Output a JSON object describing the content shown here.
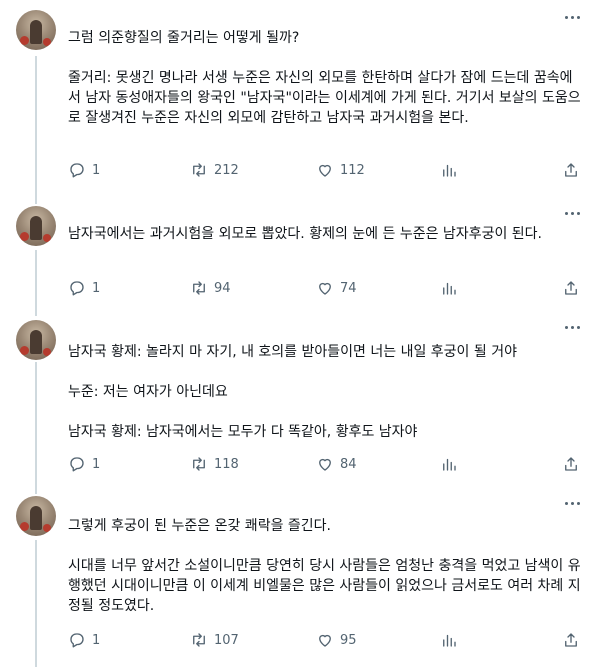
{
  "tweets": [
    {
      "text": "그럼 의준향질의 줄거리는 어떻게 될까?\n\n줄거리: 못생긴 명나라 서생 누준은 자신의 외모를 한탄하며 살다가 잠에 드는데 꿈속에서 남자 동성애자들의 왕국인 \"남자국\"이라는 이세계에 가게 된다. 거기서 보살의 도움으로 잘생겨진 누준은 자신의 외모에 감탄하고 남자국 과거시험을 본다.",
      "replies": "1",
      "retweets": "212",
      "likes": "112"
    },
    {
      "text": "남자국에서는 과거시험을 외모로 뽑았다. 황제의 눈에 든 누준은 남자후궁이 된다.",
      "replies": "1",
      "retweets": "94",
      "likes": "74"
    },
    {
      "text": "남자국 황제: 놀라지 마 자기, 내 호의를 받아들이면 너는 내일 후궁이 될 거야\n\n누준: 저는 여자가 아닌데요\n\n남자국 황제: 남자국에서는 모두가 다 똑같아, 황후도 남자야",
      "replies": "1",
      "retweets": "118",
      "likes": "84"
    },
    {
      "text": "그렇게 후궁이 된 누준은 온갖 쾌락을 즐긴다.\n\n시대를 너무 앞서간 소설이니만큼 당연히 당시 사람들은 엄청난 충격을 먹었고 남색이 유행했던 시대이니만큼 이 이세계 비엘물은 많은 사람들이 읽었으나 금서로도 여러 차례 지정될 정도였다.",
      "replies": "1",
      "retweets": "107",
      "likes": "95"
    }
  ],
  "icons": {
    "reply": "reply-icon",
    "retweet": "retweet-icon",
    "like": "like-icon",
    "views": "views-icon",
    "share": "share-icon",
    "more": "more-icon"
  },
  "colors": {
    "text": "#0f1419",
    "secondary": "#536471",
    "thread_line": "#cfd9de"
  }
}
